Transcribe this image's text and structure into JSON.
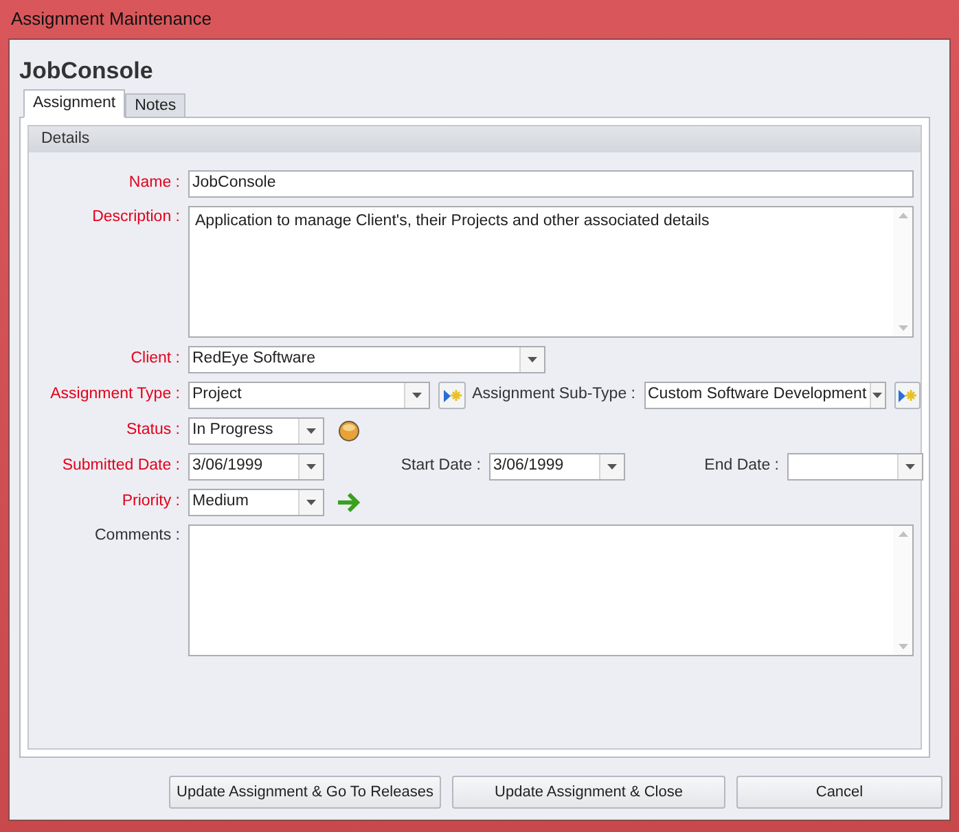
{
  "window": {
    "title": "Assignment Maintenance"
  },
  "heading": "JobConsole",
  "tabs": [
    {
      "label": "Assignment",
      "selected": true
    },
    {
      "label": "Notes",
      "selected": false
    }
  ],
  "details": {
    "title": "Details",
    "name": {
      "label": "Name :",
      "required": true,
      "value": "JobConsole"
    },
    "description": {
      "label": "Description :",
      "required": true,
      "value": "Application to manage Client's, their Projects and other associated details"
    },
    "client": {
      "label": "Client :",
      "required": true,
      "value": "RedEye Software"
    },
    "assignment_type": {
      "label": "Assignment Type :",
      "required": true,
      "value": "Project"
    },
    "assignment_sub_type": {
      "label": "Assignment Sub-Type :",
      "required": false,
      "value": "Custom Software Development"
    },
    "status": {
      "label": "Status :",
      "required": true,
      "value": "In Progress"
    },
    "submitted_date": {
      "label": "Submitted Date :",
      "required": true,
      "value": "3/06/1999"
    },
    "start_date": {
      "label": "Start Date :",
      "required": false,
      "value": "3/06/1999"
    },
    "end_date": {
      "label": "End Date :",
      "required": false
    },
    "priority": {
      "label": "Priority :",
      "required": true,
      "value": "Medium"
    },
    "comments": {
      "label": "Comments :",
      "required": false
    }
  },
  "buttons": [
    "Update Assignment & Go To Releases",
    "Update Assignment & Close",
    "Cancel"
  ]
}
